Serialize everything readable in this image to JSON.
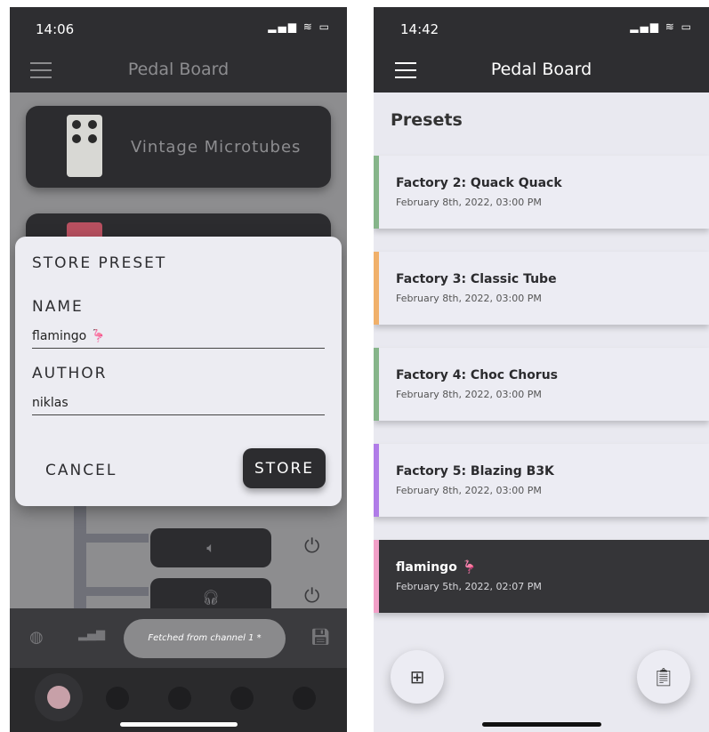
{
  "left": {
    "status": {
      "time": "14:06",
      "icons": "▂▄▆ ≋ ▭"
    },
    "header": {
      "title": "Pedal Board"
    },
    "pedals": [
      {
        "name": "Vintage Microtubes"
      }
    ],
    "dialog": {
      "title": "STORE PRESET",
      "name_label": "NAME",
      "name_value": "flamingo 🦩",
      "author_label": "AUTHOR",
      "author_value": "niklas",
      "cancel_label": "CANCEL",
      "store_label": "STORE"
    },
    "outputs": [
      {
        "icon": "speaker-icon",
        "glyph": "🔈︎"
      },
      {
        "icon": "headphones-icon",
        "glyph": "🎧︎"
      }
    ],
    "power_glyph": "⏻",
    "bottom_bar": {
      "status_text": "Fetched from channel 1 *",
      "tuner_glyph": "◍",
      "meter_glyph": "▂▄▆",
      "save_glyph": "💾︎"
    }
  },
  "right": {
    "status": {
      "time": "14:42",
      "icons": "▂▄▆ ≋ ▭"
    },
    "header": {
      "title": "Pedal Board"
    },
    "section_title": "Presets",
    "presets": [
      {
        "name": "Factory 2: Quack Quack",
        "date": "February 8th, 2022, 03:00 PM",
        "color": "#86b58a"
      },
      {
        "name": "Factory 3: Classic Tube",
        "date": "February 8th, 2022, 03:00 PM",
        "color": "#f0b06a"
      },
      {
        "name": "Factory 4: Choc Chorus",
        "date": "February 8th, 2022, 03:00 PM",
        "color": "#86b58a"
      },
      {
        "name": "Factory 5: Blazing B3K",
        "date": "February 8th, 2022, 03:00 PM",
        "color": "#b07ce8"
      },
      {
        "name": "flamingo 🦩",
        "date": "February 5th, 2022, 02:07 PM",
        "color": "#f2a0c8"
      }
    ],
    "fab_add_glyph": "⊞",
    "fab_clipboard_glyph": "📋︎"
  }
}
